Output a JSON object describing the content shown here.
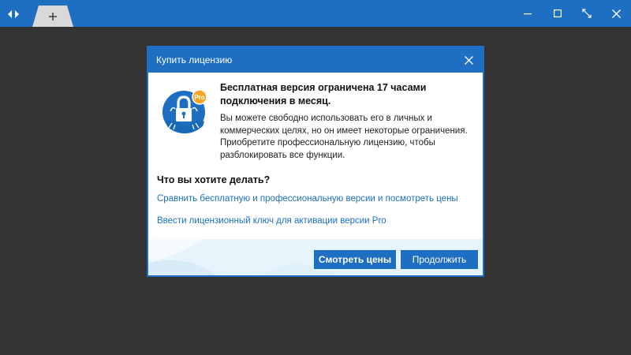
{
  "window": {
    "nav_icon": "left-right-arrows-icon",
    "tab_icon": "plus-icon",
    "controls": [
      "minimize-icon",
      "maximize-icon",
      "fullscreen-icon",
      "close-icon"
    ]
  },
  "dialog": {
    "title": "Купить лицензию",
    "badge": "Pro",
    "headline": "Бесплатная версия ограничена 17 часами подключения в месяц.",
    "description": "Вы можете свободно использовать его в личных и коммерческих целях, но он имеет некоторые ограничения. Приобретите профессиональную лицензию, чтобы разблокировать все функции.",
    "question": "Что вы хотите делать?",
    "links": {
      "compare": "Сравнить бесплатную и профессиональную версии и посмотреть цены",
      "enter_key": "Ввести лицензионный ключ для активации версии Pro"
    },
    "buttons": {
      "view_prices": "Смотреть цены",
      "continue": "Продолжить"
    }
  },
  "colors": {
    "accent": "#1e6ec1",
    "background": "#333333",
    "badge": "#f5a623",
    "link": "#1a6fc2",
    "footer": "#e8f4fb"
  }
}
